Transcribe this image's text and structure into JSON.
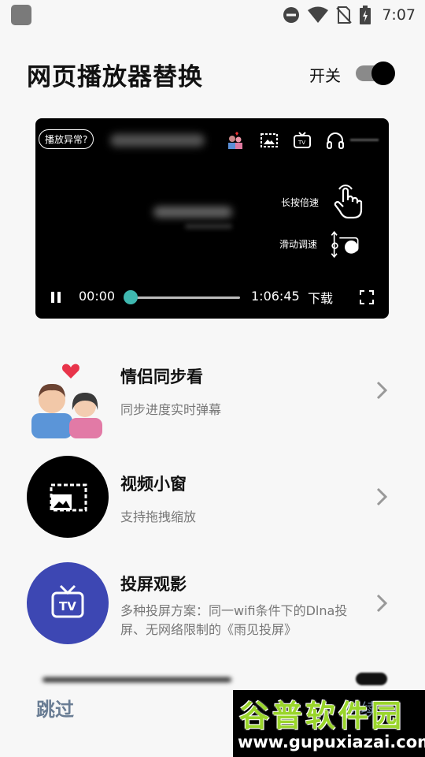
{
  "status_bar": {
    "time": "7:07"
  },
  "header": {
    "title": "网页播放器替换",
    "switch_label": "开关",
    "switch_on": true
  },
  "player": {
    "help_chip": "播放异常?",
    "hint_long_press": "长按倍速",
    "hint_slide": "滑动调速",
    "current_time": "00:00",
    "total_time": "1:06:45",
    "download_label": "下载",
    "progress": 0
  },
  "features": [
    {
      "title": "情侣同步看",
      "subtitle": "同步进度实时弹幕",
      "icon": "couple-heart-icon"
    },
    {
      "title": "视频小窗",
      "subtitle": "支持拖拽缩放",
      "icon": "picture-in-picture-icon"
    },
    {
      "title": "投屏观影",
      "subtitle": "多种投屏方案：同一wifi条件下的Dlna投屏、无网络限制的《雨见投屏》",
      "icon": "tv-cast-icon"
    }
  ],
  "footer": {
    "skip_label": "跳过",
    "continue_label": "继续"
  },
  "watermark": {
    "brand": "谷普软件园",
    "url": "www.gupuxiazai.com"
  },
  "colors": {
    "accent": "#3fb8b0",
    "cast_blue": "#3d47b3",
    "skip_gray": "#6a7d94",
    "watermark_green": "#9ad52b"
  }
}
